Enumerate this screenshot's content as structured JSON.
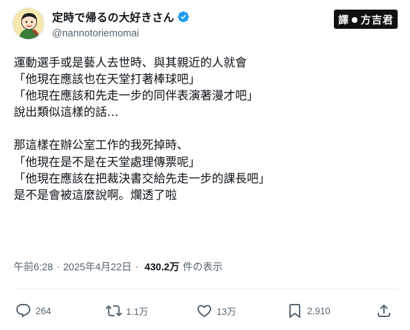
{
  "author": {
    "display_name": "定時で帰るの大好きさん",
    "handle": "@nannotoriemomai",
    "verified_icon": "verified-badge-icon",
    "avatar_icon": "cartoon-avatar"
  },
  "watermark": {
    "left": "譯",
    "right": "方吉君"
  },
  "tweet": {
    "lines": [
      "運動選手或是藝人去世時、與其親近的人就會",
      "「他現在應該也在天堂打著棒球吧」",
      "「他現在應該和先走一步的同伴表演著漫才吧」",
      "說出類似這樣的話…",
      "",
      "那這樣在辦公室工作的我死掉時、",
      "「他現在是不是在天堂處理傳票呢」",
      "「他現在應該在把裁決書交給先走一步的課長吧」",
      "是不是會被這麼說啊。爛透了啦"
    ]
  },
  "meta": {
    "time": "午前6:28",
    "date": "2025年4月22日",
    "views_count": "430.2万",
    "views_label": "件の表示"
  },
  "actions": {
    "reply": {
      "icon": "reply-icon",
      "count": "264"
    },
    "retweet": {
      "icon": "retweet-icon",
      "count": "1.1万"
    },
    "like": {
      "icon": "heart-icon",
      "count": "13万"
    },
    "bookmark": {
      "icon": "bookmark-icon",
      "count": "2,910"
    },
    "share": {
      "icon": "share-icon"
    }
  },
  "colors": {
    "text": "#0f1419",
    "secondary": "#536471",
    "verified": "#1d9bf0",
    "divider": "#eff3f4"
  }
}
